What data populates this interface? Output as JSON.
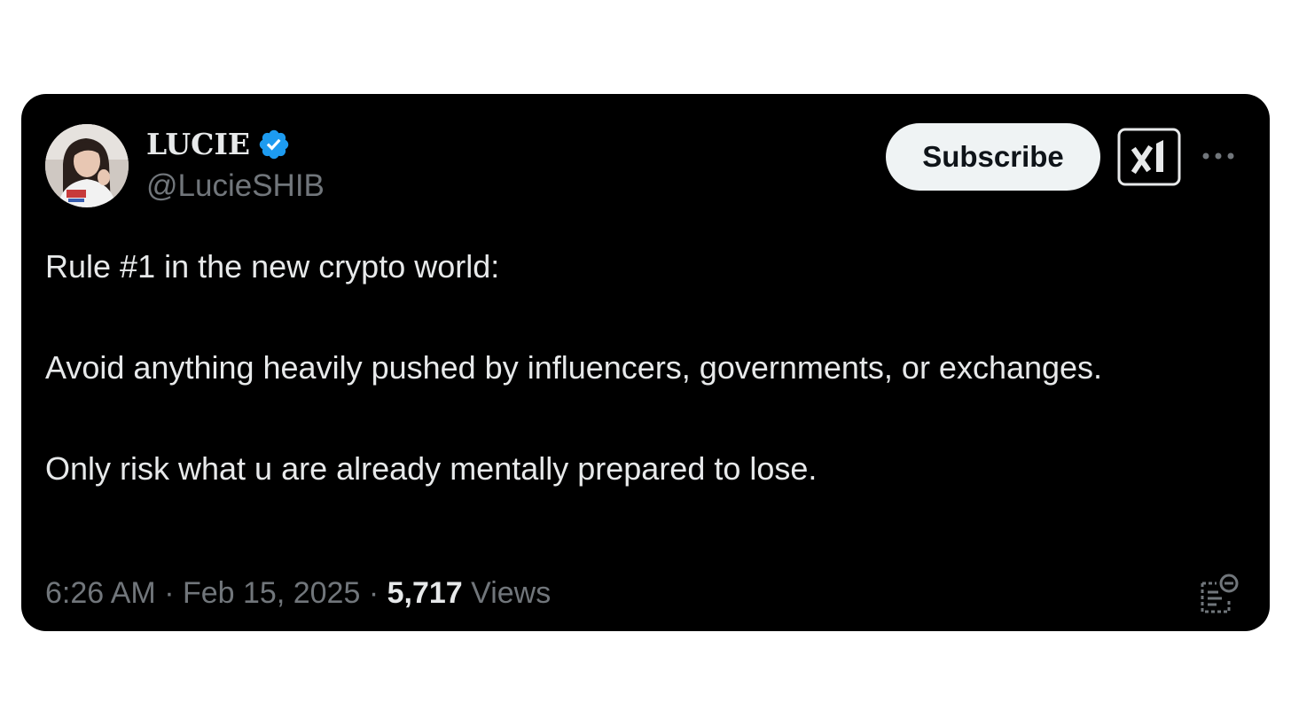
{
  "author": {
    "display_name": "LUCIE",
    "handle": "@LucieSHIB",
    "verified_icon": "verified-badge-icon",
    "avatar": "profile-photo"
  },
  "actions": {
    "subscribe_label": "Subscribe",
    "grok_icon": "grok-logo-icon",
    "more_icon": "more-horizontal-icon"
  },
  "tweet": {
    "line_1": "Rule #1 in the new crypto world:",
    "line_2": "Avoid anything heavily pushed by influencers, governments, or exchanges.",
    "line_3": "Only risk what u are already mentally prepared to lose."
  },
  "meta": {
    "time": "6:26 AM",
    "separator": "·",
    "date": "Feb 15, 2025",
    "views_count": "5,717",
    "views_label": "Views",
    "notes_icon": "community-notes-icon"
  },
  "colors": {
    "card_bg": "#000000",
    "text_primary": "#e7e9ea",
    "text_secondary": "#71767b",
    "verified_blue": "#1d9bf0",
    "button_bg": "#eff3f4"
  }
}
